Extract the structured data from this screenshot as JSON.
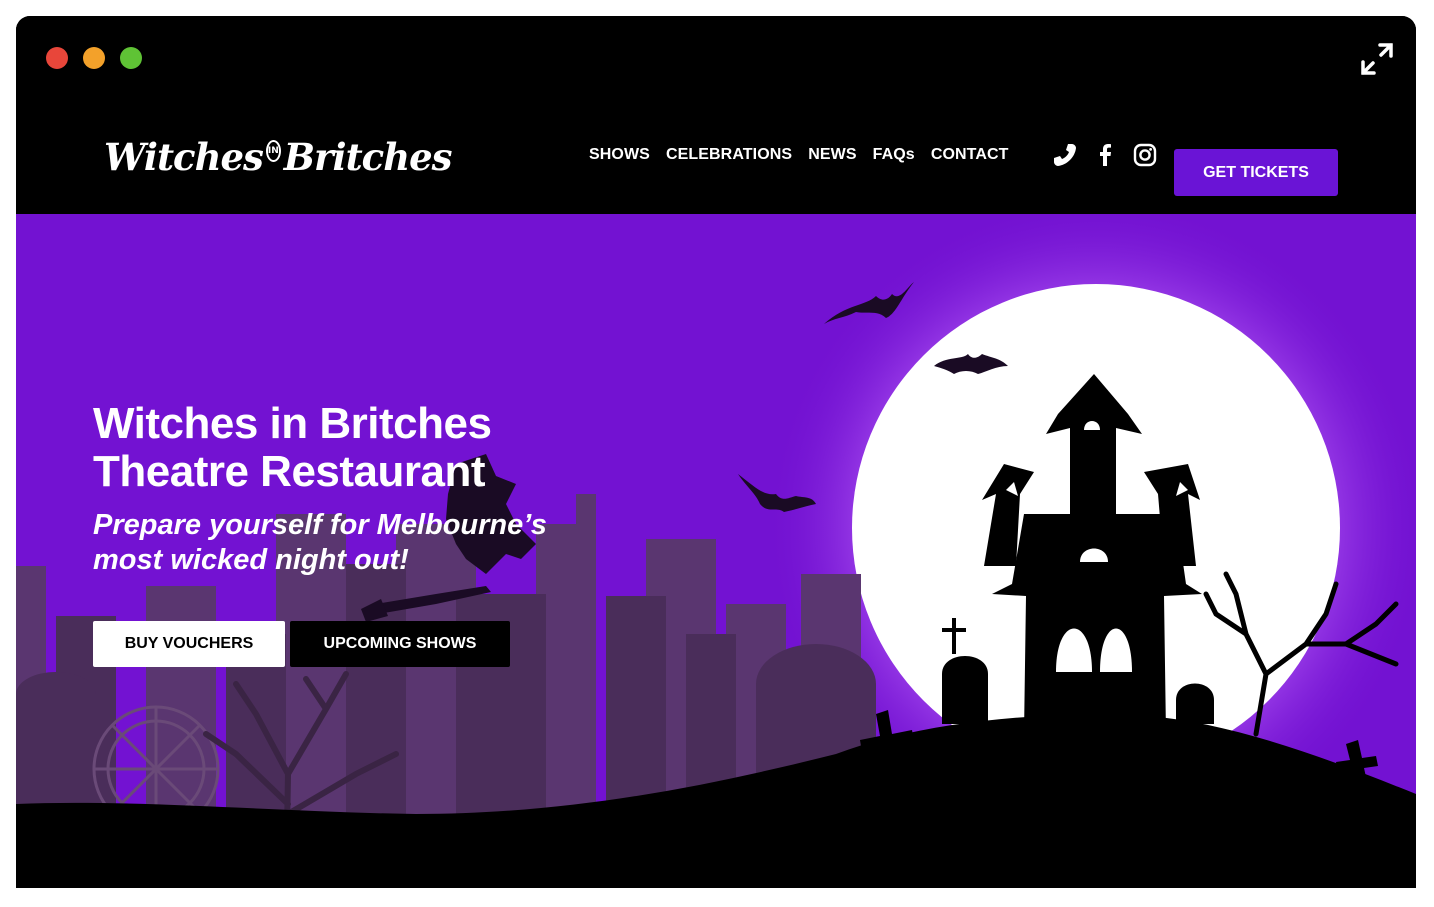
{
  "brand": {
    "logo_word_1": "Witches",
    "logo_in": "IN",
    "logo_word_2": "Britches"
  },
  "nav": {
    "items": [
      {
        "label": "SHOWS"
      },
      {
        "label": "CELEBRATIONS"
      },
      {
        "label": "NEWS"
      },
      {
        "label": "FAQs"
      },
      {
        "label": "CONTACT"
      }
    ],
    "cta_label": "GET TICKETS"
  },
  "social": {
    "icons": [
      "phone-icon",
      "facebook-icon",
      "instagram-icon"
    ]
  },
  "hero": {
    "title_line_1": "Witches in Britches",
    "title_line_2": "Theatre Restaurant",
    "subtitle_line_1": "Prepare yourself for Melbourne’s",
    "subtitle_line_2": "most wicked night out!",
    "buttons": {
      "vouchers": "BUY VOUCHERS",
      "shows": "UPCOMING SHOWS"
    }
  },
  "colors": {
    "accent": "#6a14d6",
    "hero_bg": "#7312d2",
    "moon": "#ffffff",
    "skyline": "#4a2d5a"
  }
}
